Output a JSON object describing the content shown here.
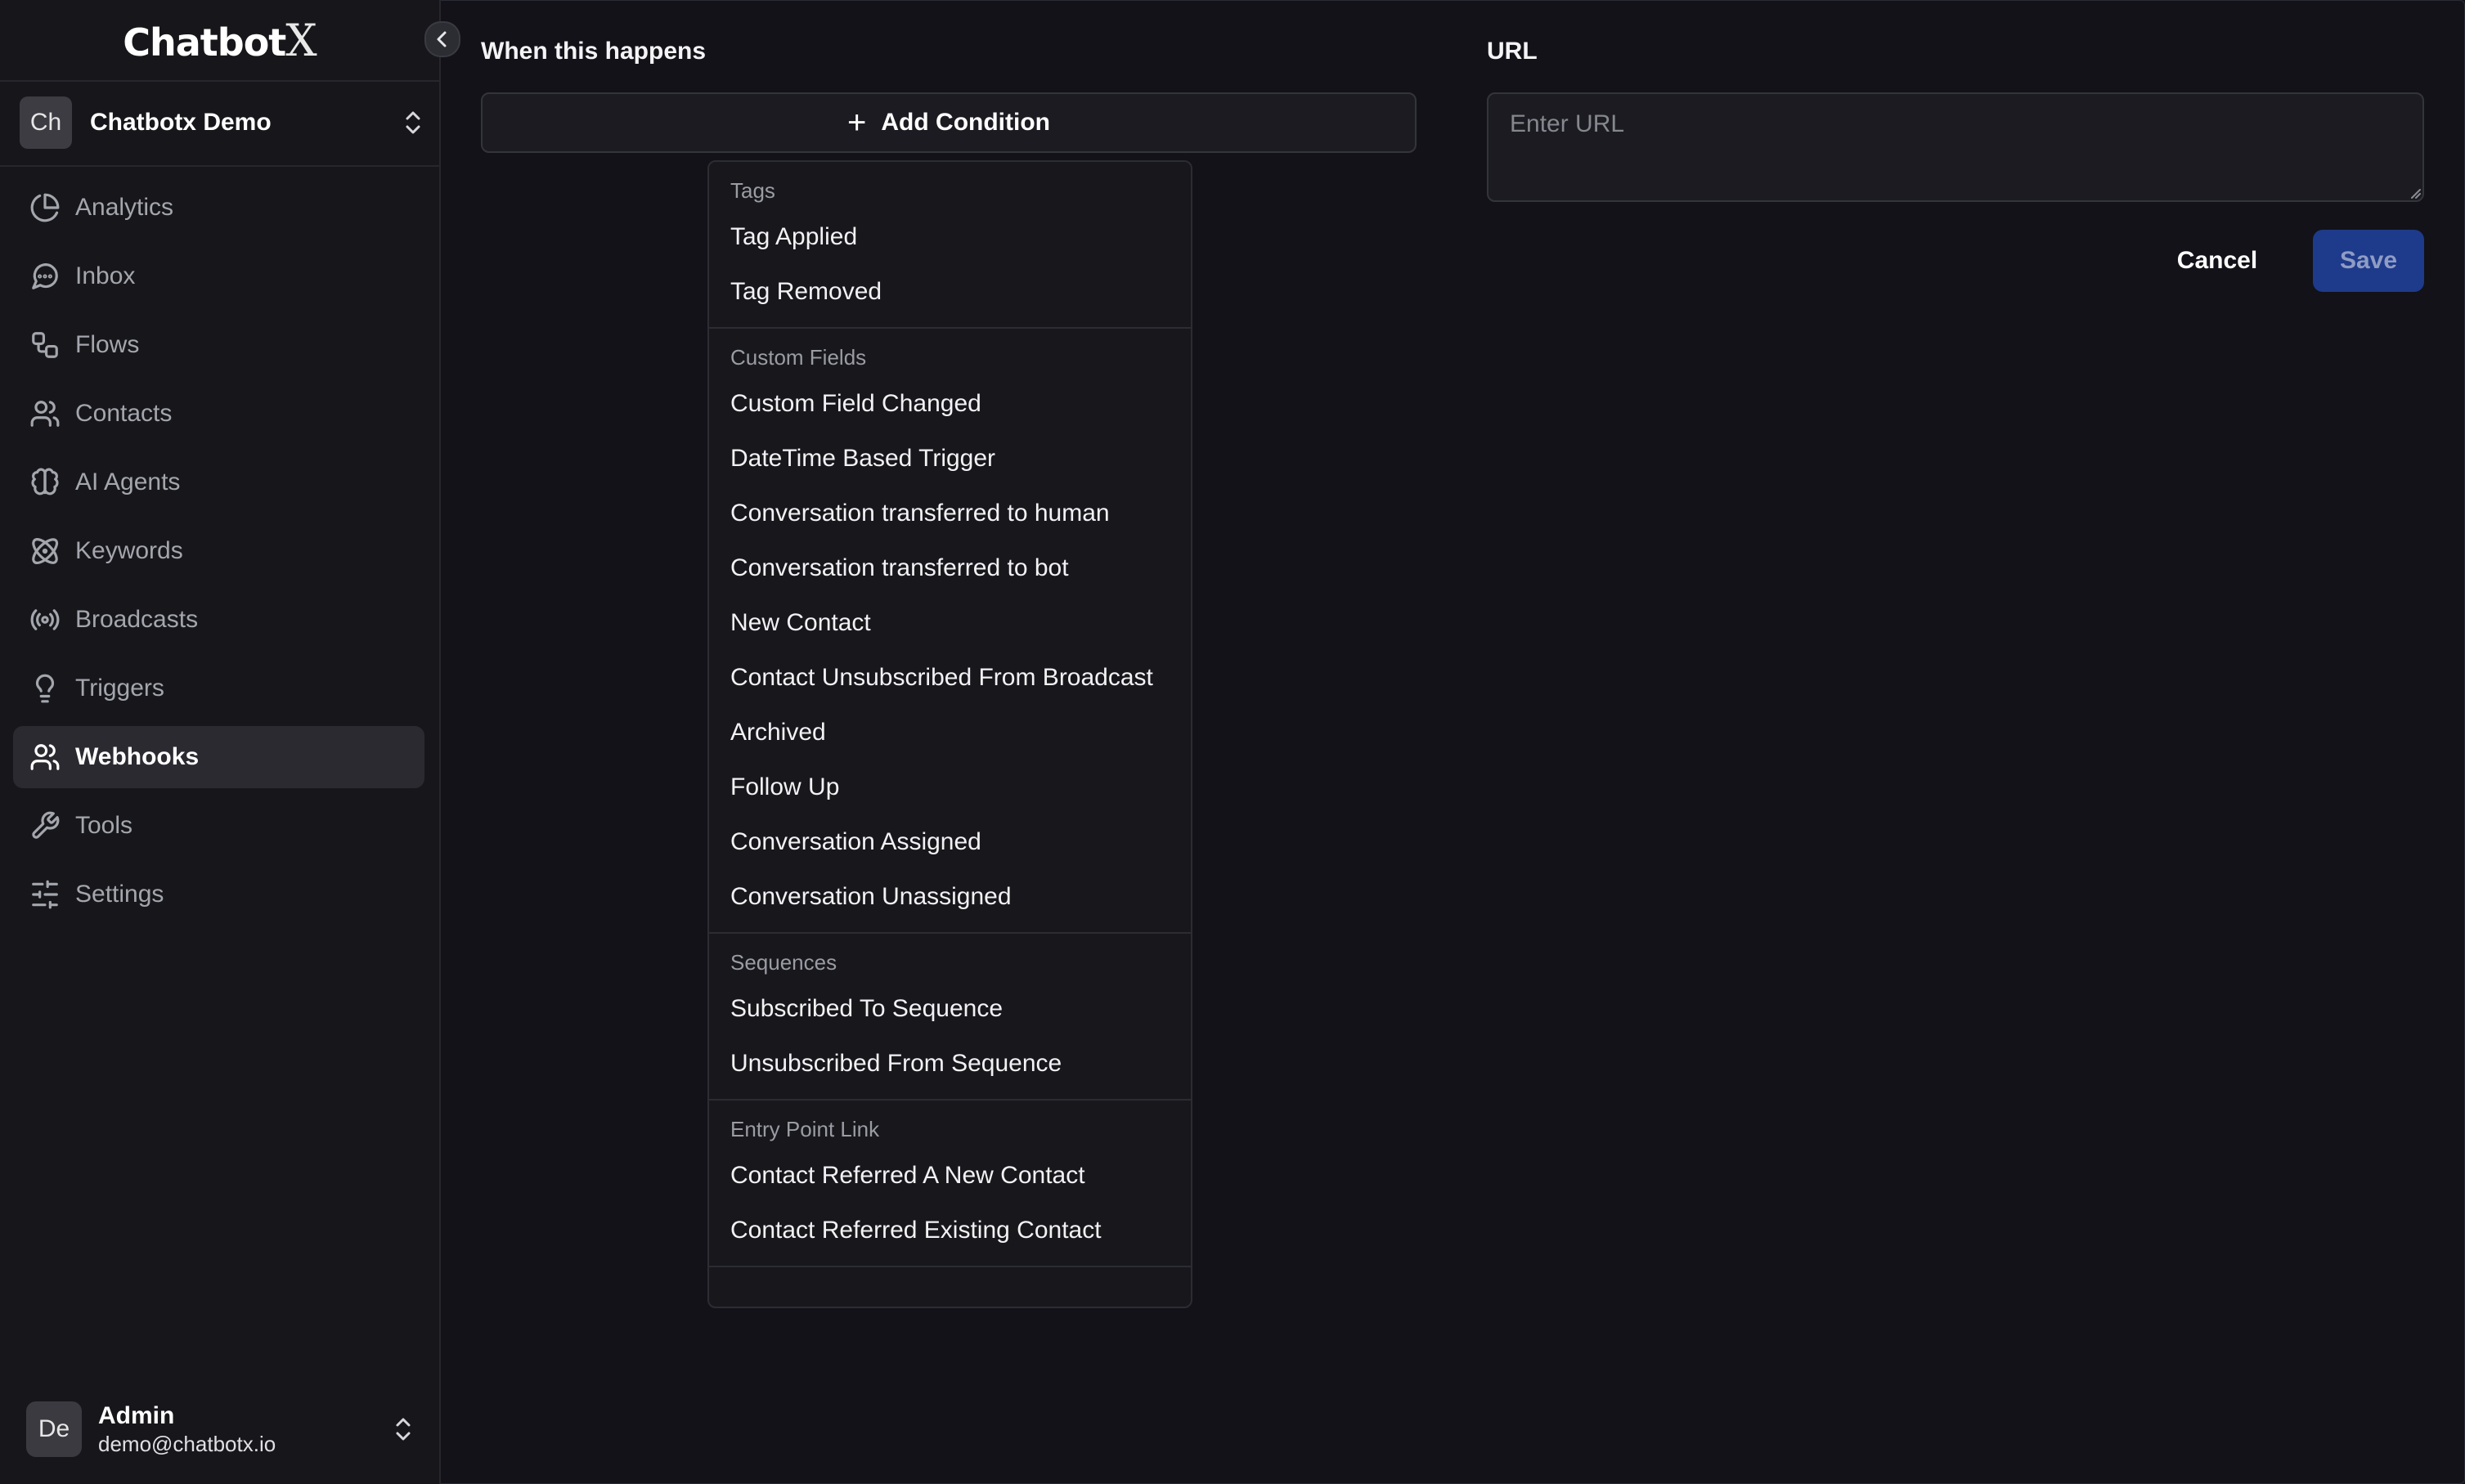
{
  "app": {
    "logo_text": "Chatbot",
    "logo_mark": "X"
  },
  "workspace": {
    "avatar": "Ch",
    "name": "Chatbotx Demo"
  },
  "nav": [
    {
      "label": "Analytics",
      "icon": "pie-chart-icon"
    },
    {
      "label": "Inbox",
      "icon": "message-circle-icon"
    },
    {
      "label": "Flows",
      "icon": "workflow-icon"
    },
    {
      "label": "Contacts",
      "icon": "users-icon"
    },
    {
      "label": "AI Agents",
      "icon": "brain-icon"
    },
    {
      "label": "Keywords",
      "icon": "atom-icon"
    },
    {
      "label": "Broadcasts",
      "icon": "radio-icon"
    },
    {
      "label": "Triggers",
      "icon": "lightbulb-icon"
    },
    {
      "label": "Webhooks",
      "icon": "users-icon",
      "active": true
    },
    {
      "label": "Tools",
      "icon": "wrench-icon"
    },
    {
      "label": "Settings",
      "icon": "sliders-icon"
    }
  ],
  "user": {
    "avatar": "De",
    "name": "Admin",
    "email": "demo@chatbotx.io"
  },
  "form": {
    "when_label": "When this happens",
    "add_condition_label": "Add Condition",
    "url_label": "URL",
    "url_placeholder": "Enter URL",
    "cancel_label": "Cancel",
    "save_label": "Save"
  },
  "dropdown": {
    "groups": [
      {
        "title": "Tags",
        "items": [
          "Tag Applied",
          "Tag Removed"
        ]
      },
      {
        "title": "Custom Fields",
        "items": [
          "Custom Field Changed",
          "DateTime Based Trigger",
          "Conversation transferred to human",
          "Conversation transferred to bot",
          "New Contact",
          "Contact Unsubscribed From Broadcast",
          "Archived",
          "Follow Up",
          "Conversation Assigned",
          "Conversation Unassigned"
        ]
      },
      {
        "title": "Sequences",
        "items": [
          "Subscribed To Sequence",
          "Unsubscribed From Sequence"
        ]
      },
      {
        "title": "Entry Point Link",
        "items": [
          "Contact Referred A New Contact",
          "Contact Referred Existing Contact"
        ]
      }
    ]
  },
  "colors": {
    "background": "#121218",
    "sidebar": "#17171b",
    "active_nav": "#2a2a30",
    "save_button": "#1e3a8a"
  }
}
